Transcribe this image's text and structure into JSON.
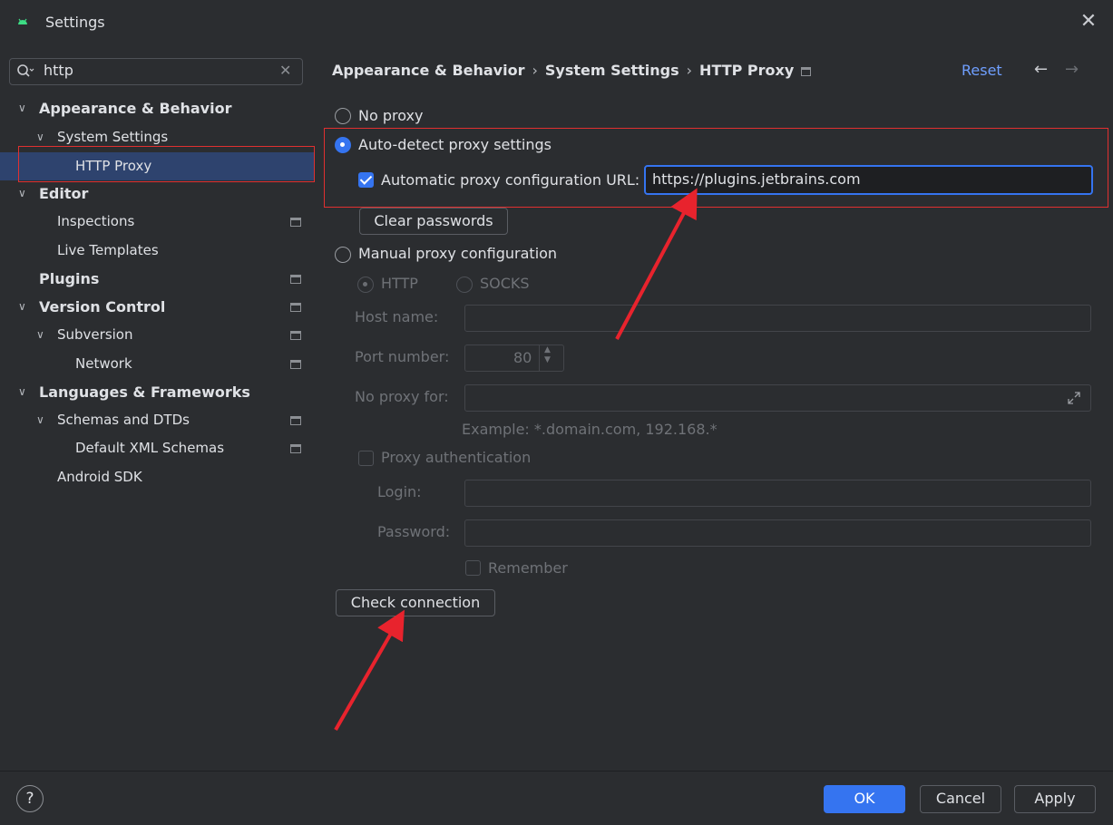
{
  "window": {
    "title": "Settings"
  },
  "sidebar": {
    "search_value": "http",
    "items": [
      {
        "label": "Appearance & Behavior",
        "level": 0,
        "expanded": true,
        "bold": true
      },
      {
        "label": "System Settings",
        "level": 1,
        "expanded": true,
        "bold": false
      },
      {
        "label": "HTTP Proxy",
        "level": 2,
        "selected": true
      },
      {
        "label": "Editor",
        "level": 0,
        "expanded": true,
        "bold": true
      },
      {
        "label": "Inspections",
        "level": 1,
        "has_icon": true
      },
      {
        "label": "Live Templates",
        "level": 1
      },
      {
        "label": "Plugins",
        "level": 0,
        "bold": true,
        "has_icon": true
      },
      {
        "label": "Version Control",
        "level": 0,
        "expanded": true,
        "bold": true,
        "has_icon": true
      },
      {
        "label": "Subversion",
        "level": 1,
        "expanded": true,
        "has_icon": true
      },
      {
        "label": "Network",
        "level": 2,
        "has_icon": true
      },
      {
        "label": "Languages & Frameworks",
        "level": 0,
        "expanded": true,
        "bold": true
      },
      {
        "label": "Schemas and DTDs",
        "level": 1,
        "expanded": true,
        "has_icon": true
      },
      {
        "label": "Default XML Schemas",
        "level": 2,
        "has_icon": true
      },
      {
        "label": "Android SDK",
        "level": 1
      }
    ]
  },
  "breadcrumb": [
    "Appearance & Behavior",
    "System Settings",
    "HTTP Proxy"
  ],
  "header": {
    "reset_label": "Reset",
    "back_icon": "arrow-left-icon",
    "forward_icon": "arrow-right-icon"
  },
  "proxy": {
    "no_proxy_label": "No proxy",
    "auto_detect_label": "Auto-detect proxy settings",
    "auto_url_label": "Automatic proxy configuration URL:",
    "auto_url_checked": true,
    "auto_url_value": "https://plugins.jetbrains.com",
    "clear_passwords_label": "Clear passwords",
    "manual_label": "Manual proxy configuration",
    "selected_mode": "auto-detect",
    "manual": {
      "http_label": "HTTP",
      "socks_label": "SOCKS",
      "host_label": "Host name:",
      "host_value": "",
      "port_label": "Port number:",
      "port_value": "80",
      "no_proxy_for_label": "No proxy for:",
      "no_proxy_for_value": "",
      "example_text": "Example: *.domain.com, 192.168.*",
      "auth_label": "Proxy authentication",
      "login_label": "Login:",
      "password_label": "Password:",
      "remember_label": "Remember"
    },
    "check_connection_label": "Check connection"
  },
  "footer": {
    "help_label": "?",
    "ok_label": "OK",
    "cancel_label": "Cancel",
    "apply_label": "Apply"
  },
  "colors": {
    "accent": "#3574f0",
    "highlight_outline": "#e03030",
    "annotation_arrow": "#e8232d",
    "background": "#2b2d30",
    "selection": "#2e436e"
  }
}
